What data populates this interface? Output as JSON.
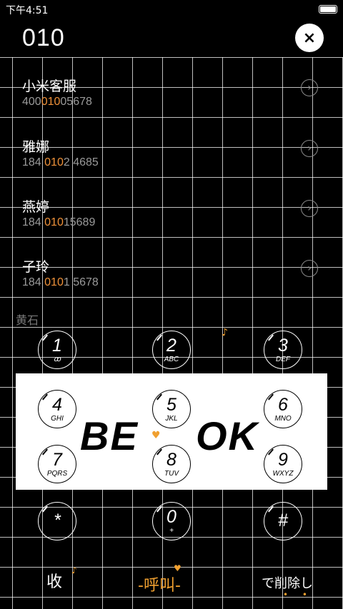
{
  "status_bar": {
    "time": "下午4:51"
  },
  "dialer": {
    "input": "010",
    "clear_label": "×"
  },
  "contacts": [
    {
      "name": "小米客服",
      "number_pre": "400",
      "number_match": "010",
      "number_post": "05678"
    },
    {
      "name": "雅娜",
      "number_pre": "184 ",
      "number_match": "010",
      "number_post": "2 4685"
    },
    {
      "name": "燕婷",
      "number_pre": "184 ",
      "number_match": "010",
      "number_post": "15689"
    },
    {
      "name": "子玲",
      "number_pre": "184 ",
      "number_match": "010",
      "number_post": "1 5678"
    }
  ],
  "detail_icon": "chevron-right-icon",
  "partial_section": "黄石",
  "keypad": [
    {
      "digit": "1",
      "letters": "ꝏ"
    },
    {
      "digit": "2",
      "letters": "ABC"
    },
    {
      "digit": "3",
      "letters": "DEF"
    },
    {
      "digit": "4",
      "letters": "GHI"
    },
    {
      "digit": "5",
      "letters": "JKL"
    },
    {
      "digit": "6",
      "letters": "MNO"
    },
    {
      "digit": "7",
      "letters": "PQRS"
    },
    {
      "digit": "8",
      "letters": "TUV"
    },
    {
      "digit": "9",
      "letters": "WXYZ"
    },
    {
      "digit": "*",
      "letters": ""
    },
    {
      "digit": "0",
      "letters": "+"
    },
    {
      "digit": "#",
      "letters": ""
    }
  ],
  "banner": {
    "left_text": "BE",
    "right_text": "OK",
    "heart": "♥"
  },
  "decor": {
    "note": "♪"
  },
  "bottom_bar": {
    "left": "收",
    "center": "-呼叫-",
    "right": "で削除し",
    "dots": "• •"
  },
  "colors": {
    "accent": "#f0923a",
    "background": "#000000",
    "grid": "#ffffff"
  }
}
